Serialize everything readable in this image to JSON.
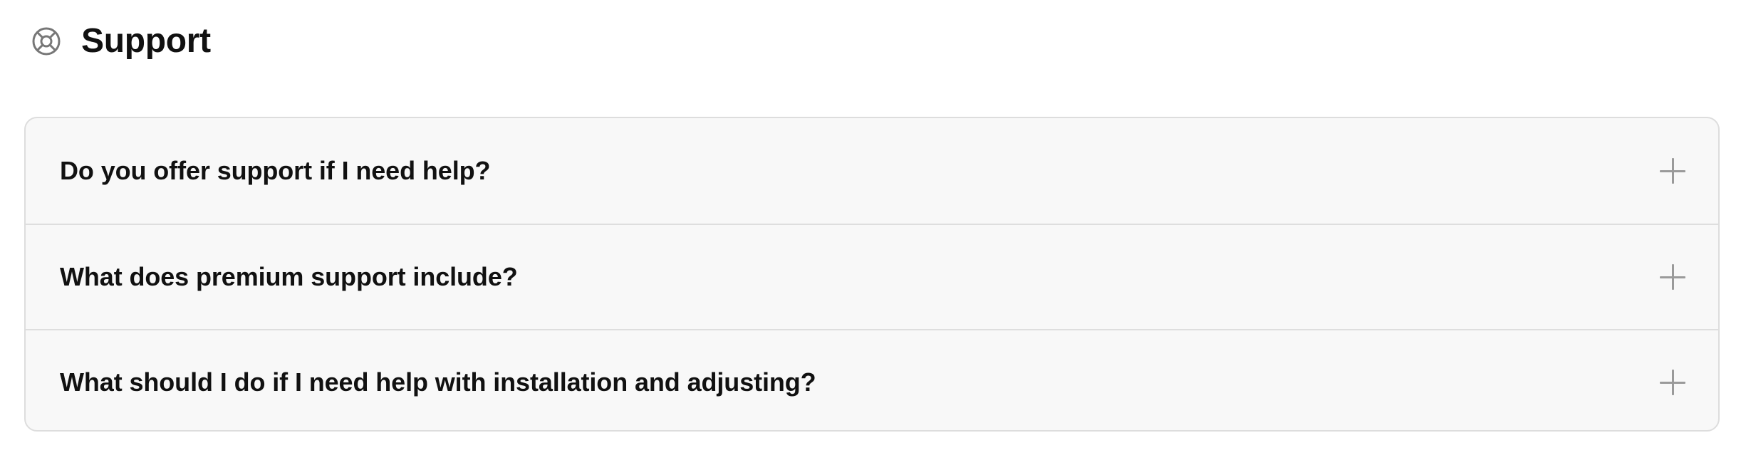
{
  "header": {
    "icon": "lifebuoy-icon",
    "title": "Support"
  },
  "faq": {
    "items": [
      {
        "question": "Do you offer support if I need help?",
        "icon": "plus-icon",
        "expanded": false
      },
      {
        "question": "What does premium support include?",
        "icon": "plus-icon",
        "expanded": false
      },
      {
        "question": "What should I do if I need help with installation and adjusting?",
        "icon": "plus-icon",
        "expanded": false
      }
    ]
  },
  "colors": {
    "text": "#111111",
    "panel_background": "#f8f8f8",
    "border": "#dddddd",
    "icon_gray": "#9a9a9a"
  }
}
